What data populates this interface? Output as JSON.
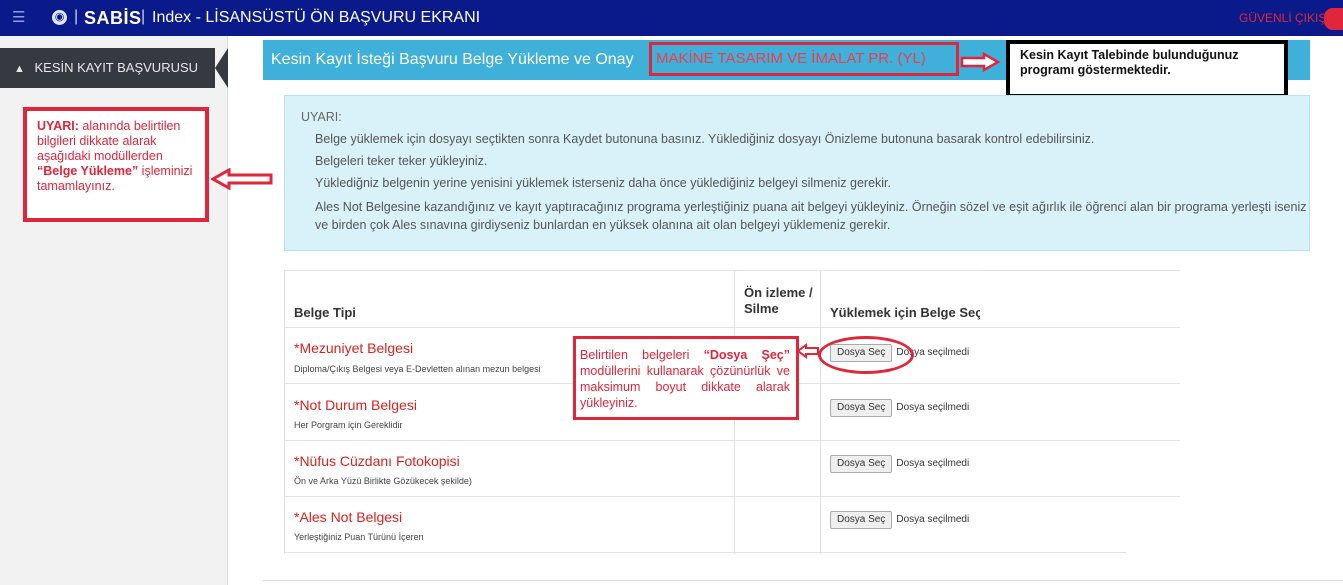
{
  "topbar": {
    "menu_icon": "hamburger-icon",
    "brand": "SABİS",
    "title": "Index - LİSANSÜSTÜ ÖN BAŞVURU EKRANI",
    "logout": "GÜVENLİ ÇIKIŞ",
    "bg_color": "#0a1a8a"
  },
  "sidebar": {
    "items": [
      {
        "label": "KESİN KAYIT BAŞVURUSU",
        "icon": "thumbs-up-icon"
      }
    ]
  },
  "annotations": {
    "left_bold": "UYARI:",
    "left_text1": " alanında belirtilen bilgileri dikkate alarak aşağıdaki modüllerden ",
    "left_quote": "“Belge Yükleme”",
    "left_text2": " işleminizi tamamlayınız.",
    "top_right": "Kesin Kayıt Talebinde bulunduğunuz programı göstermektedir.",
    "mid_text1": "Belirtilen belgeleri ",
    "mid_bold": "“Dosya Şeç”",
    "mid_text2": " modüllerini kullanarak çözünürlük ve maksimum boyut dikkate alarak yükleyiniz."
  },
  "header": {
    "title": "Kesin Kayıt İsteği Başvuru Belge Yükleme ve Onay",
    "program": "MAKİNE TASARIM VE İMALAT PR. (YL)",
    "accent_color": "#3fb0d9"
  },
  "warning": {
    "title": "UYARI:",
    "lines": [
      "Belge yüklemek için dosyayı seçtikten sonra Kaydet butonuna basınız. Yüklediğiniz dosyayı Önizleme butonuna basarak kontrol edebilirsiniz.",
      "Belgeleri teker teker yükleyiniz.",
      "Yüklediğniz belgenin yerine yenisini yüklemek isterseniz daha önce yüklediğiniz belgeyi silmeniz gerekir.",
      "Ales Not Belgesine kazandığınız ve kayıt yaptıracağınız programa yerleştiğiniz puana ait belgeyi yükleyiniz. Örneğin sözel ve eşit ağırlık ile öğrenci alan bir programa yerleşti iseniz ve birden çok Ales sınavına girdiyseniz bunlardan en yüksek olanına ait olan belgeyi yüklemeniz gerekir."
    ]
  },
  "table": {
    "headers": [
      "Belge Tipi",
      "Ön izleme / Silme",
      "Yüklemek için Belge Seç"
    ],
    "rows": [
      {
        "title": "*Mezuniyet Belgesi",
        "sub": "Diploma/Çıkış Belgesi veya E-Devletten alınan mezun belgesi",
        "button": "Dosya Seç",
        "status": "Dosya seçilmedi"
      },
      {
        "title": "*Not Durum Belgesi",
        "sub": "Her Porgram için Gereklidir",
        "button": "Dosya Seç",
        "status": "Dosya seçilmedi"
      },
      {
        "title": "*Nüfus Cüzdanı Fotokopisi",
        "sub": "Ön ve Arka Yüzü Birlikte Gözükecek şekilde)",
        "button": "Dosya Seç",
        "status": "Dosya seçilmedi"
      },
      {
        "title": "*Ales Not Belgesi",
        "sub": "Yerleştiğiniz Puan Türünü İçeren",
        "button": "Dosya Seç",
        "status": "Dosya seçilmedi"
      }
    ]
  }
}
